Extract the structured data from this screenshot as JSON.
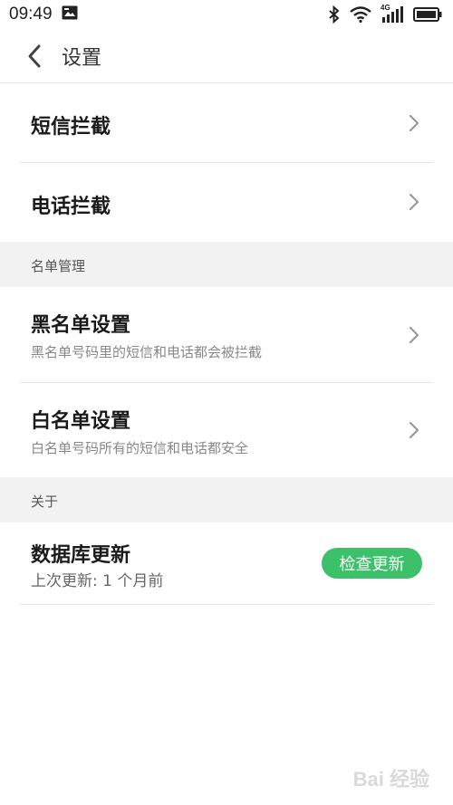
{
  "status_bar": {
    "time": "09:49",
    "network": "4G",
    "icons": [
      "image-icon",
      "bluetooth-icon",
      "wifi-icon",
      "signal-icon",
      "battery-icon"
    ]
  },
  "header": {
    "title": "设置",
    "back_icon": "chevron-left-icon"
  },
  "rows": {
    "sms_block": {
      "title": "短信拦截"
    },
    "call_block": {
      "title": "电话拦截"
    },
    "blacklist": {
      "title": "黑名单设置",
      "subtitle": "黑名单号码里的短信和电话都会被拦截"
    },
    "whitelist": {
      "title": "白名单设置",
      "subtitle": "白名单号码所有的短信和电话都安全"
    },
    "database": {
      "title": "数据库更新",
      "subtitle": "上次更新: 1 个月前",
      "button_label": "检查更新"
    }
  },
  "sections": {
    "list_management": "名单管理",
    "about": "关于"
  },
  "watermark": "Bai 经验",
  "colors": {
    "accent_green": "#3cc06a",
    "section_bg": "#f2f2f2",
    "divider": "#e4e4e4",
    "chevron": "#999999"
  }
}
